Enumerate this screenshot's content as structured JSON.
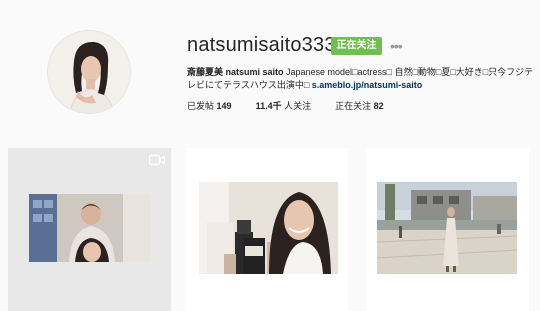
{
  "profile": {
    "username": "natsumisaito333",
    "follow_label": "正在关注",
    "more_label": "•••",
    "bio_name": "斎藤夏美 natsumi saito",
    "bio_text": " Japanese model□actress□ 自然□動物□夏□大好き□只今フジテレビにてテラスハウス出演中□ ",
    "bio_link": "s.ameblo.jp/natsumi-saito"
  },
  "stats": {
    "posts_label": "已发帖",
    "posts_value": "149",
    "followers_value": "11.4千",
    "followers_label": "人关注",
    "following_label": "正在关注",
    "following_value": "82"
  },
  "posts": [
    {
      "type": "video",
      "icon": "video-camera-icon"
    },
    {
      "type": "photo"
    },
    {
      "type": "photo"
    }
  ],
  "colors": {
    "accent": "#70c050",
    "background": "#fafafa",
    "link": "#003569"
  }
}
